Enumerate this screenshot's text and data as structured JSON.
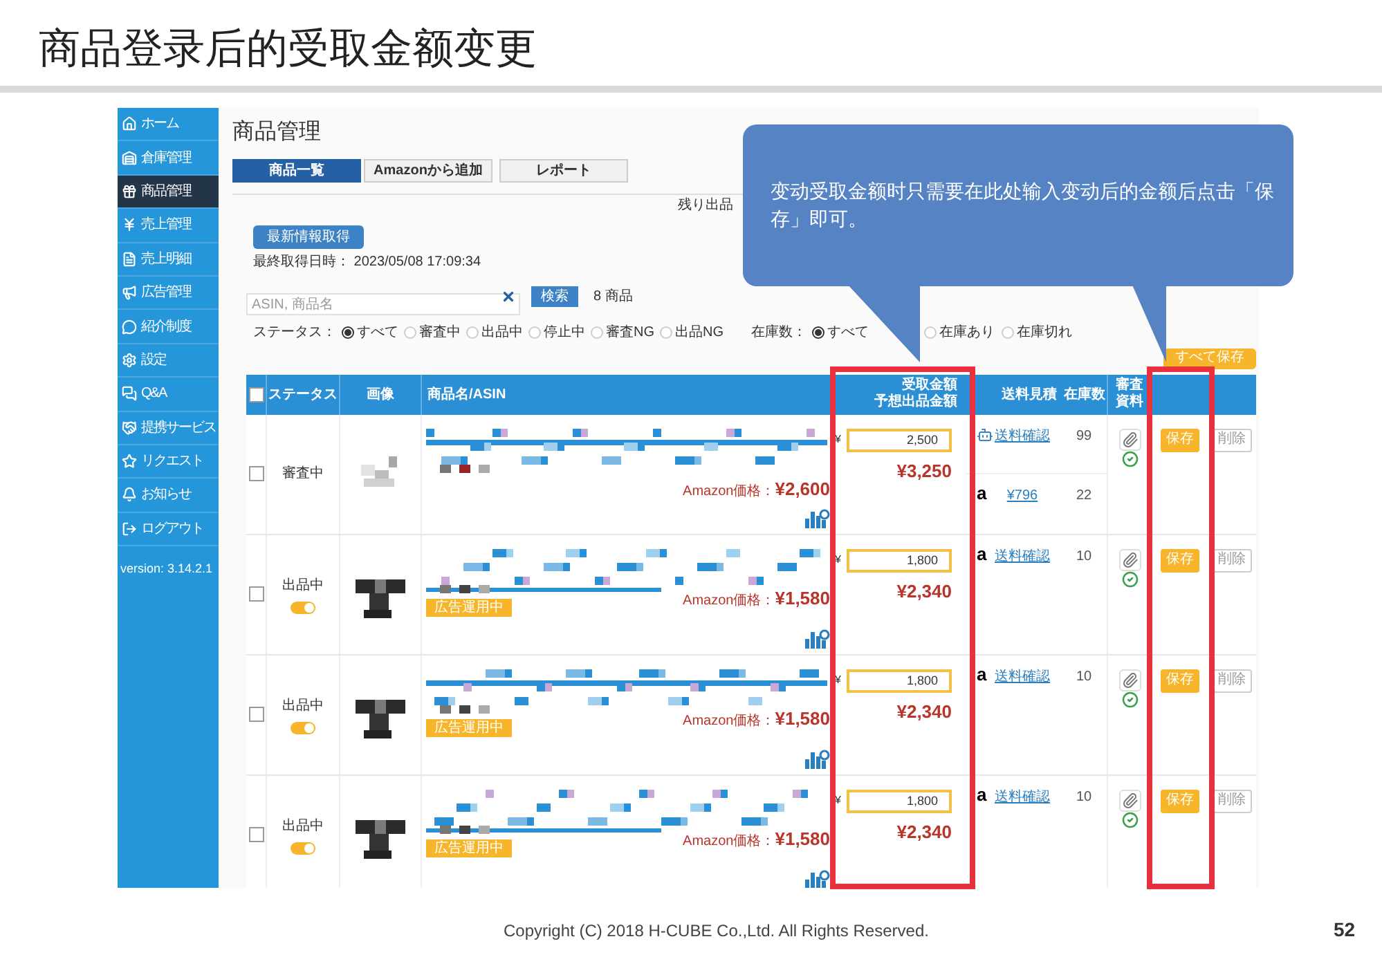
{
  "slide": {
    "title": "商品登录后的受取金额变更",
    "footer": "Copyright (C) 2018 H-CUBE Co.,Ltd. All Rights Reserved.",
    "page": "52"
  },
  "sidebar": {
    "items": [
      {
        "label": "ホーム",
        "selected": false
      },
      {
        "label": "倉庫管理",
        "selected": false
      },
      {
        "label": "商品管理",
        "selected": true
      },
      {
        "label": "売上管理",
        "selected": false
      },
      {
        "label": "売上明細",
        "selected": false
      },
      {
        "label": "広告管理",
        "selected": false
      },
      {
        "label": "紹介制度",
        "selected": false
      },
      {
        "label": "設定",
        "selected": false
      },
      {
        "label": "Q&A",
        "selected": false
      },
      {
        "label": "提携サービス",
        "selected": false
      },
      {
        "label": "リクエスト",
        "selected": false
      },
      {
        "label": "お知らせ",
        "selected": false
      },
      {
        "label": "ログアウト",
        "selected": false
      }
    ],
    "version": "version: 3.14.2.1"
  },
  "main": {
    "title": "商品管理",
    "tabs": [
      {
        "label": "商品一覧",
        "selected": true
      },
      {
        "label": "Amazonから追加",
        "selected": false
      },
      {
        "label": "レポート",
        "selected": false
      }
    ],
    "remaining": "残り出品",
    "refresh_button": "最新情報取得",
    "last_fetched": "最終取得日時： 2023/05/08 17:09:34",
    "search": {
      "placeholder": "ASIN, 商品名"
    },
    "search_button": "検索",
    "count": "8 商品",
    "status_filter": {
      "label": "ステータス：",
      "options": [
        {
          "label": "すべて",
          "selected": true
        },
        {
          "label": "審査中",
          "selected": false
        },
        {
          "label": "出品中",
          "selected": false
        },
        {
          "label": "停止中",
          "selected": false
        },
        {
          "label": "審査NG",
          "selected": false
        },
        {
          "label": "出品NG",
          "selected": false
        }
      ]
    },
    "stock_filter": {
      "label": "在庫数：",
      "options": [
        {
          "label": "すべて",
          "selected": true
        },
        {
          "label": "在庫あり",
          "selected": false
        },
        {
          "label": "在庫切れ",
          "selected": false
        }
      ]
    },
    "save_all_button": "すべて保存"
  },
  "table": {
    "all_checked": false,
    "columns": {
      "status": "ステータス",
      "image": "画像",
      "name": "商品名/ASIN",
      "receive": "受取金額",
      "expected": "予想出品金額",
      "shipping": "送料見積",
      "stock": "在庫数",
      "docs": [
        "審査",
        "資料"
      ]
    },
    "rows": [
      {
        "checked": false,
        "status": "審査中",
        "amazon_price": "Amazon価格：**¥2,600**",
        "currency": "¥",
        "receive": "2,500",
        "expected": "¥3,250",
        "shipping": [
          {
            "kind": "robot",
            "link": "送料確認",
            "stock": "99"
          },
          {
            "kind": "amazon",
            "mark": "a",
            "link": "¥796",
            "stock": "22"
          }
        ],
        "save": "保存",
        "delete": "削除"
      },
      {
        "checked": false,
        "status": "出品中",
        "toggle": {
          "on": true
        },
        "ad_badge": "広告運用中",
        "amazon_price": "Amazon価格：**¥1,580**",
        "currency": "¥",
        "receive": "1,800",
        "expected": "¥2,340",
        "shipping": [
          {
            "kind": "amazon",
            "mark": "a",
            "link": "送料確認",
            "stock": "10"
          }
        ],
        "save": "保存",
        "delete": "削除"
      },
      {
        "checked": false,
        "status": "出品中",
        "toggle": {
          "on": true
        },
        "ad_badge": "広告運用中",
        "amazon_price": "Amazon価格：**¥1,580**",
        "currency": "¥",
        "receive": "1,800",
        "expected": "¥2,340",
        "shipping": [
          {
            "kind": "amazon",
            "mark": "a",
            "link": "送料確認",
            "stock": "10"
          }
        ],
        "save": "保存",
        "delete": "削除"
      },
      {
        "checked": false,
        "status": "出品中",
        "toggle": {
          "on": true
        },
        "ad_badge": "広告運用中",
        "amazon_price": "Amazon価格：**¥1,580**",
        "currency": "¥",
        "receive": "1,800",
        "expected": "¥2,340",
        "shipping": [
          {
            "kind": "amazon",
            "mark": "a",
            "link": "送料確認",
            "stock": "10"
          }
        ],
        "save": "保存",
        "delete": "削除"
      }
    ]
  },
  "callout": {
    "text": "变动受取金额时只需要在此处输入变动后的金额后点击「保存」即可。"
  }
}
